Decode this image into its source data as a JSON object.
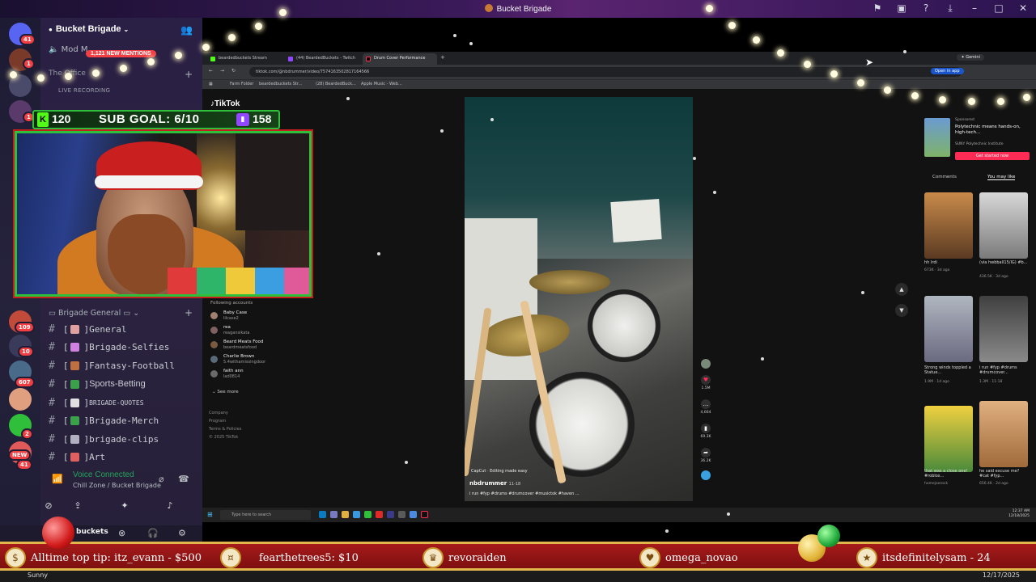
{
  "window": {
    "title": "Bucket Brigade"
  },
  "servers": {
    "badges": [
      "41",
      "1",
      "1",
      "109",
      "10",
      "607",
      "2",
      "41"
    ],
    "new_label": "NEW"
  },
  "sidebar": {
    "server_name": "Bucket Brigade",
    "mod_channel": "Mod M",
    "new_mentions": "1,121 NEW MENTIONS",
    "office_label": "The Office",
    "live_recording": "LIVE RECORDING",
    "category": "Brigade General",
    "channels": [
      {
        "label": "General",
        "emoji_color": "#e0a0a0"
      },
      {
        "label": "Brigade-Selfies",
        "emoji_color": "#d080e0"
      },
      {
        "label": "Fantasy-Football",
        "emoji_color": "#c07040"
      },
      {
        "label": "Sports-Betting",
        "emoji_color": "#3aa14a"
      },
      {
        "label": "BRIGADE-QUOTES",
        "emoji_color": "#e0e0e0"
      },
      {
        "label": "Brigade-Merch",
        "emoji_color": "#3aa14a"
      },
      {
        "label": "brigade-clips",
        "emoji_color": "#b0b0c0"
      },
      {
        "label": "Art",
        "emoji_color": "#e06060"
      }
    ],
    "voice_status": "Voice Connected",
    "voice_channel": "Chill Zone / Bucket Brigade",
    "username": "buckets"
  },
  "browser": {
    "tabs": [
      "beardedbuckets Stream",
      "(44) BeardedBuckets - Twitch",
      "Drum Cover Performance"
    ],
    "gemini": "Gemini",
    "url": "tiktok.com/@nbdrummer/video/7574163502817164566",
    "open_in_app": "Open in app",
    "bookmarks": [
      "Farm Folder",
      "beardedbuckets Str...",
      "(28) BeardedBuck...",
      "Apple Music - Web..."
    ]
  },
  "tiktok": {
    "logo": "TikTok",
    "following_header": "Following accounts",
    "accounts": [
      {
        "name": "Baby Case",
        "handle": "lilcase2"
      },
      {
        "name": "rea",
        "handle": "reagansikata"
      },
      {
        "name": "Beard Meats Food",
        "handle": "beardmeatsfood"
      },
      {
        "name": "Charlie Brown",
        "handle": "5.4withamissingdoor"
      },
      {
        "name": "faith ann",
        "handle": "lad0814"
      }
    ],
    "see_more": "See more",
    "footer": [
      "Company",
      "Program",
      "Terms & Policies",
      "© 2025 TikTok"
    ],
    "video": {
      "capcut": "CapCut · Editing made easy",
      "author": "nbdrummer",
      "date": "11-18",
      "caption": "i run #fyp #drums #drumcover #musictok #haven ..."
    },
    "actions": [
      {
        "icon": "heart",
        "count": "1.5M"
      },
      {
        "icon": "comment",
        "count": "4,664"
      },
      {
        "icon": "bookmark",
        "count": "69.3K"
      },
      {
        "icon": "share",
        "count": "36.2K"
      }
    ],
    "sponsored": {
      "label": "Sponsored",
      "title": "Polytechnic means hands-on, high-tech...",
      "org": "SUNY Polytechnic Institute",
      "cta": "Get started now"
    },
    "right_tabs": [
      "Comments",
      "You may like"
    ],
    "suggestions": [
      {
        "caption": "hh Irdi",
        "meta": "673K · 3d ago"
      },
      {
        "caption": "(via hwbball15/IG) #b...",
        "meta": "436.5K · 3d ago"
      },
      {
        "caption": "Strong winds toppled a Statue...",
        "meta": "1.9M · 1d ago"
      },
      {
        "caption": "i run #fyp #drums #drumcover...",
        "meta": "1.3M · 11-18"
      },
      {
        "caption": "that was a close one! #roblox...",
        "meta": "homejoerock"
      },
      {
        "caption": "he said excuse me? #cat #fyp...",
        "meta": "656.4K · 2d ago"
      }
    ],
    "taskbar_search": "Type here to search",
    "clock_time": "12:37 AM",
    "clock_date": "12/18/2025"
  },
  "overlay": {
    "kick_count": "120",
    "sub_goal": "SUB GOAL: 6/10",
    "twitch_count": "158",
    "tips": [
      "Alltime top tip: itz_evann - $500",
      "fearthetrees5: $10",
      "revoraiden",
      "omega_novao",
      "itsdefinitelysam - 24"
    ]
  },
  "os": {
    "weather": "Sunny",
    "date": "12/17/2025"
  },
  "colors": {
    "accent_green": "#2fbf3a",
    "tip_red": "#a61a1a",
    "gold": "#e2b64a",
    "tiktok_red": "#fe2c55",
    "discord_green": "#23a55a"
  }
}
